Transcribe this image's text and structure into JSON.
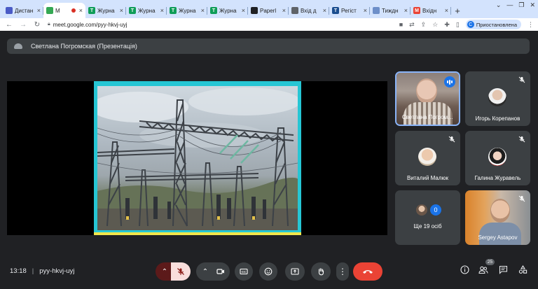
{
  "browser": {
    "tabs": [
      {
        "title": "Дистан",
        "favicon_color": "#4a5bc6",
        "favicon_glyph": "calendar-icon",
        "active": false
      },
      {
        "title": "M",
        "favicon_color": "#34a853",
        "favicon_glyph": "meet-icon",
        "active": true,
        "recording": true
      },
      {
        "title": "Журна",
        "favicon_color": "#0f9d58",
        "favicon_glyph": "T",
        "active": false
      },
      {
        "title": "Журна",
        "favicon_color": "#0f9d58",
        "favicon_glyph": "T",
        "active": false
      },
      {
        "title": "Журна",
        "favicon_color": "#0f9d58",
        "favicon_glyph": "T",
        "active": false
      },
      {
        "title": "Журна",
        "favicon_color": "#0f9d58",
        "favicon_glyph": "T",
        "active": false
      },
      {
        "title": "Paperl",
        "favicon_color": "#202124",
        "favicon_glyph": "paperless-icon",
        "active": false
      },
      {
        "title": "Вхід д",
        "favicon_color": "#5f6368",
        "favicon_glyph": "upload-icon",
        "active": false
      },
      {
        "title": "Регіст",
        "favicon_color": "#1a4d8f",
        "favicon_glyph": "T",
        "active": false
      },
      {
        "title": "Тиждн",
        "favicon_color": "#6d8fc9",
        "favicon_glyph": "scale-icon",
        "active": false
      },
      {
        "title": "Вхідн",
        "favicon_color": "#ea4335",
        "favicon_glyph": "M",
        "active": false
      }
    ],
    "url": "meet.google.com/pyy-hkvj-uyj",
    "profile_label": "Приостановлена",
    "profile_initial": "C"
  },
  "meet": {
    "presentation_banner": "Светлана Погромская (Презентація)",
    "participants": [
      {
        "name": "Светлана Погром…",
        "speaking": true
      },
      {
        "name": "Игорь Корепанов",
        "muted": true
      },
      {
        "name": "Виталий Малюк",
        "muted": true
      },
      {
        "name": "Галина Журавель",
        "muted": true
      },
      {
        "name": "Ще 19 осіб",
        "count_badge": "0"
      },
      {
        "name": "Sergey Astapov",
        "muted": true
      }
    ],
    "time": "13:18",
    "meeting_code": "pyy-hkvj-uyj",
    "people_count": "25",
    "colors": {
      "end_call": "#ea4335",
      "mic_off": "#f9dedc",
      "accent": "#1a73e8"
    }
  }
}
